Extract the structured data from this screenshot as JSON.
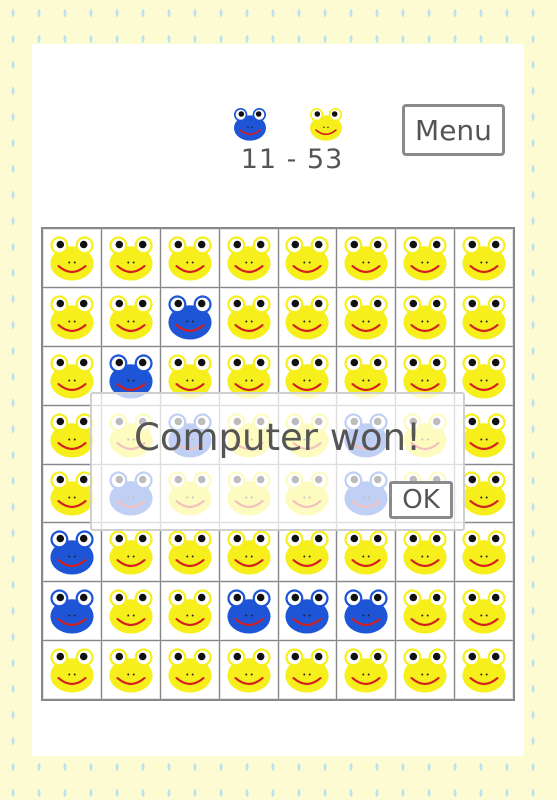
{
  "theme": {
    "background": "#fdfbd2",
    "raindrop": "#bfe3ef",
    "yellow_frog": "#f6ef1c",
    "blue_frog": "#1d55d6",
    "mouth": "#d41f1f"
  },
  "score": {
    "blue_icon": "blue-frog-icon",
    "yellow_icon": "yellow-frog-icon",
    "text": "11 - 53",
    "blue": 11,
    "yellow": 53
  },
  "menu": {
    "label": "Menu"
  },
  "board": {
    "rows": [
      [
        "Y",
        "Y",
        "Y",
        "Y",
        "Y",
        "Y",
        "Y",
        "Y"
      ],
      [
        "Y",
        "Y",
        "B",
        "Y",
        "Y",
        "Y",
        "Y",
        "Y"
      ],
      [
        "Y",
        "B",
        "Y",
        "Y",
        "Y",
        "Y",
        "Y",
        "Y"
      ],
      [
        "Y",
        "Y",
        "B",
        "Y",
        "Y",
        "B",
        "Y",
        "Y"
      ],
      [
        "Y",
        "B",
        "Y",
        "Y",
        "Y",
        "B",
        "Y",
        "Y"
      ],
      [
        "B",
        "Y",
        "Y",
        "Y",
        "Y",
        "Y",
        "Y",
        "Y"
      ],
      [
        "B",
        "Y",
        "Y",
        "B",
        "B",
        "B",
        "Y",
        "Y"
      ],
      [
        "Y",
        "Y",
        "Y",
        "Y",
        "Y",
        "Y",
        "Y",
        "Y"
      ]
    ]
  },
  "dialog": {
    "message": "Computer won!",
    "ok_label": "OK"
  }
}
